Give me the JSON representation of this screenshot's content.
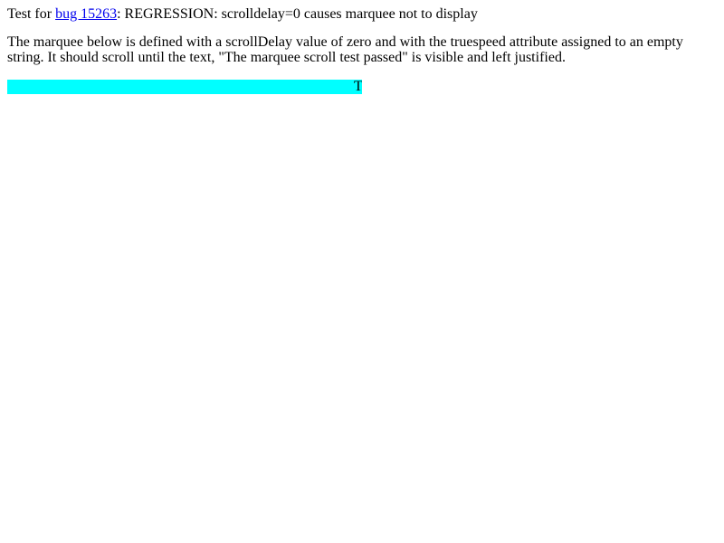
{
  "header": {
    "prefix": "Test for ",
    "bug_link_text": "bug 15263",
    "suffix": ": REGRESSION: scrolldelay=0 causes marquee not to display"
  },
  "description": {
    "line1": "The marquee below is defined with a scrollDelay value of zero and with the truespeed attribute assigned to an empty",
    "line2": "string. It should scroll until the text, \"The marquee scroll test passed\" is visible and left justified."
  },
  "marquee": {
    "visible_text": "T",
    "background_color": "#00ffff"
  },
  "colors": {
    "link": "#0000ee",
    "text": "#000000",
    "page_background": "#ffffff"
  }
}
